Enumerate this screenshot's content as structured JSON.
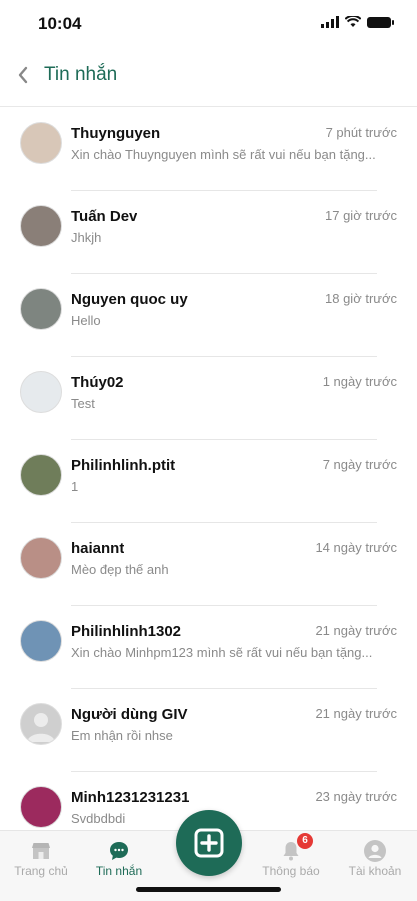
{
  "status_bar": {
    "time": "10:04"
  },
  "header": {
    "title": "Tin nhắn"
  },
  "conversations": [
    {
      "name": "Thuynguyen",
      "time": "7 phút trước",
      "preview": "Xin chào Thuynguyen mình sẽ rất vui nếu bạn tặng...",
      "avatar_color": "#d8c7b8"
    },
    {
      "name": "Tuấn Dev",
      "time": "17 giờ trước",
      "preview": "Jhkjh",
      "avatar_color": "#8a7f78"
    },
    {
      "name": "Nguyen quoc uy",
      "time": "18 giờ trước",
      "preview": "Hello",
      "avatar_color": "#7e8580"
    },
    {
      "name": "Thúy02",
      "time": "1 ngày trước",
      "preview": "Test",
      "avatar_color": "#e6eaed"
    },
    {
      "name": "Philinhlinh.ptit",
      "time": "7 ngày trước",
      "preview": "1",
      "avatar_color": "#6f7d5a"
    },
    {
      "name": "haiannt",
      "time": "14 ngày trước",
      "preview": "Mèo đẹp thế anh",
      "avatar_color": "#b98f86"
    },
    {
      "name": "Philinhlinh1302",
      "time": "21 ngày trước",
      "preview": "Xin chào Minhpm123 mình sẽ rất vui nếu bạn tặng...",
      "avatar_color": "#6f93b5"
    },
    {
      "name": "Người dùng GIV",
      "time": "21 ngày trước",
      "preview": "Em nhận rồi nhse",
      "avatar_color": "#cfcfcf"
    },
    {
      "name": "Minh1231231231",
      "time": "23 ngày trước",
      "preview": "Svdbdbdi",
      "avatar_color": "#9c2a5e"
    }
  ],
  "bottom_nav": {
    "home_label": "Trang chủ",
    "messages_label": "Tin nhắn",
    "notifications_label": "Thông báo",
    "notifications_badge": "6",
    "account_label": "Tài khoản"
  },
  "colors": {
    "accent": "#1e6b57",
    "badge": "#e53935"
  }
}
